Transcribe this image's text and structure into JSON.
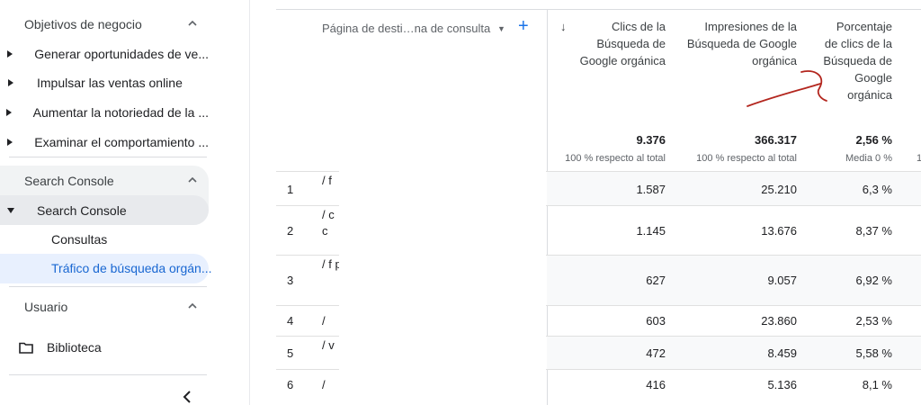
{
  "sidebar": {
    "business_objectives": "Objetivos de negocio",
    "objective_items": [
      "Generar oportunidades de ve...",
      "Impulsar las ventas online",
      "Aumentar la notoriedad de la ...",
      "Examinar el comportamiento ..."
    ],
    "search_console_section": "Search Console",
    "search_console_item": "Search Console",
    "queries": "Consultas",
    "organic_traffic": "Tráfico de búsqueda orgán...",
    "user_section": "Usuario",
    "library": "Biblioteca",
    "collapse_icon": "chevron-left-icon"
  },
  "table": {
    "dimension_header": "Página de desti…na de consulta",
    "columns": [
      {
        "label": "Clics de la Búsqueda de Google orgánica",
        "total": "9.376",
        "total_sub": "100 % respecto al total"
      },
      {
        "label": "Impresiones de la Búsqueda de Google orgánica",
        "total": "366.317",
        "total_sub": "100 % respecto al total"
      },
      {
        "label": "Porcentaje de clics de la Búsqueda de Google orgánica",
        "total": "2,56 %",
        "total_sub": "Media 0 %"
      }
    ],
    "rows": [
      {
        "num": "1",
        "dim": "/ f",
        "clicks": "1.587",
        "impressions": "25.210",
        "ctr": "6,3 %"
      },
      {
        "num": "2",
        "dim": "/ c c",
        "clicks": "1.145",
        "impressions": "13.676",
        "ctr": "8,37 %"
      },
      {
        "num": "3",
        "dim": "/ f p",
        "clicks": "627",
        "impressions": "9.057",
        "ctr": "6,92 %"
      },
      {
        "num": "4",
        "dim": "/",
        "clicks": "603",
        "impressions": "23.860",
        "ctr": "2,53 %"
      },
      {
        "num": "5",
        "dim": "/ v",
        "clicks": "472",
        "impressions": "8.459",
        "ctr": "5,58 %"
      },
      {
        "num": "6",
        "dim": "/",
        "clicks": "416",
        "impressions": "5.136",
        "ctr": "8,1 %"
      }
    ]
  },
  "colors": {
    "accent": "#1a73e8",
    "active_bg": "#e8f0fe",
    "annotation": "#b3261e"
  }
}
